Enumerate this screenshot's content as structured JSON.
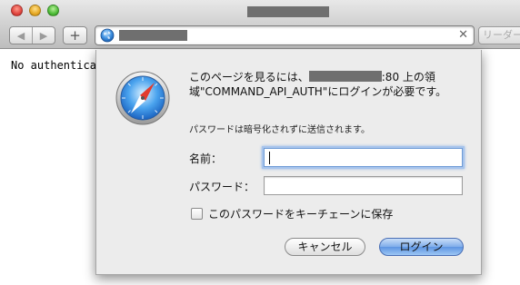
{
  "toolbar": {
    "back_glyph": "◀",
    "forward_glyph": "▶",
    "add_glyph": "+",
    "clear_glyph": "✕",
    "reader_label": "リーダー"
  },
  "page": {
    "body_text": "No authentication header found"
  },
  "auth_dialog": {
    "message_prefix": "このページを見るには、",
    "message_suffix": ":80 上の領域\"COMMAND_API_AUTH\"にログインが必要です。",
    "sub_message": "パスワードは暗号化されずに送信されます。",
    "name_label": "名前：",
    "name_value": "",
    "password_label": "パスワード：",
    "password_value": "",
    "remember_label": "このパスワードをキーチェーンに保存",
    "remember_checked": false,
    "cancel_label": "キャンセル",
    "login_label": "ログイン"
  },
  "colors": {
    "accent": "#5e95e2",
    "redaction": "#6f6f6f"
  },
  "icons": [
    "globe-icon",
    "safari-compass-icon"
  ]
}
